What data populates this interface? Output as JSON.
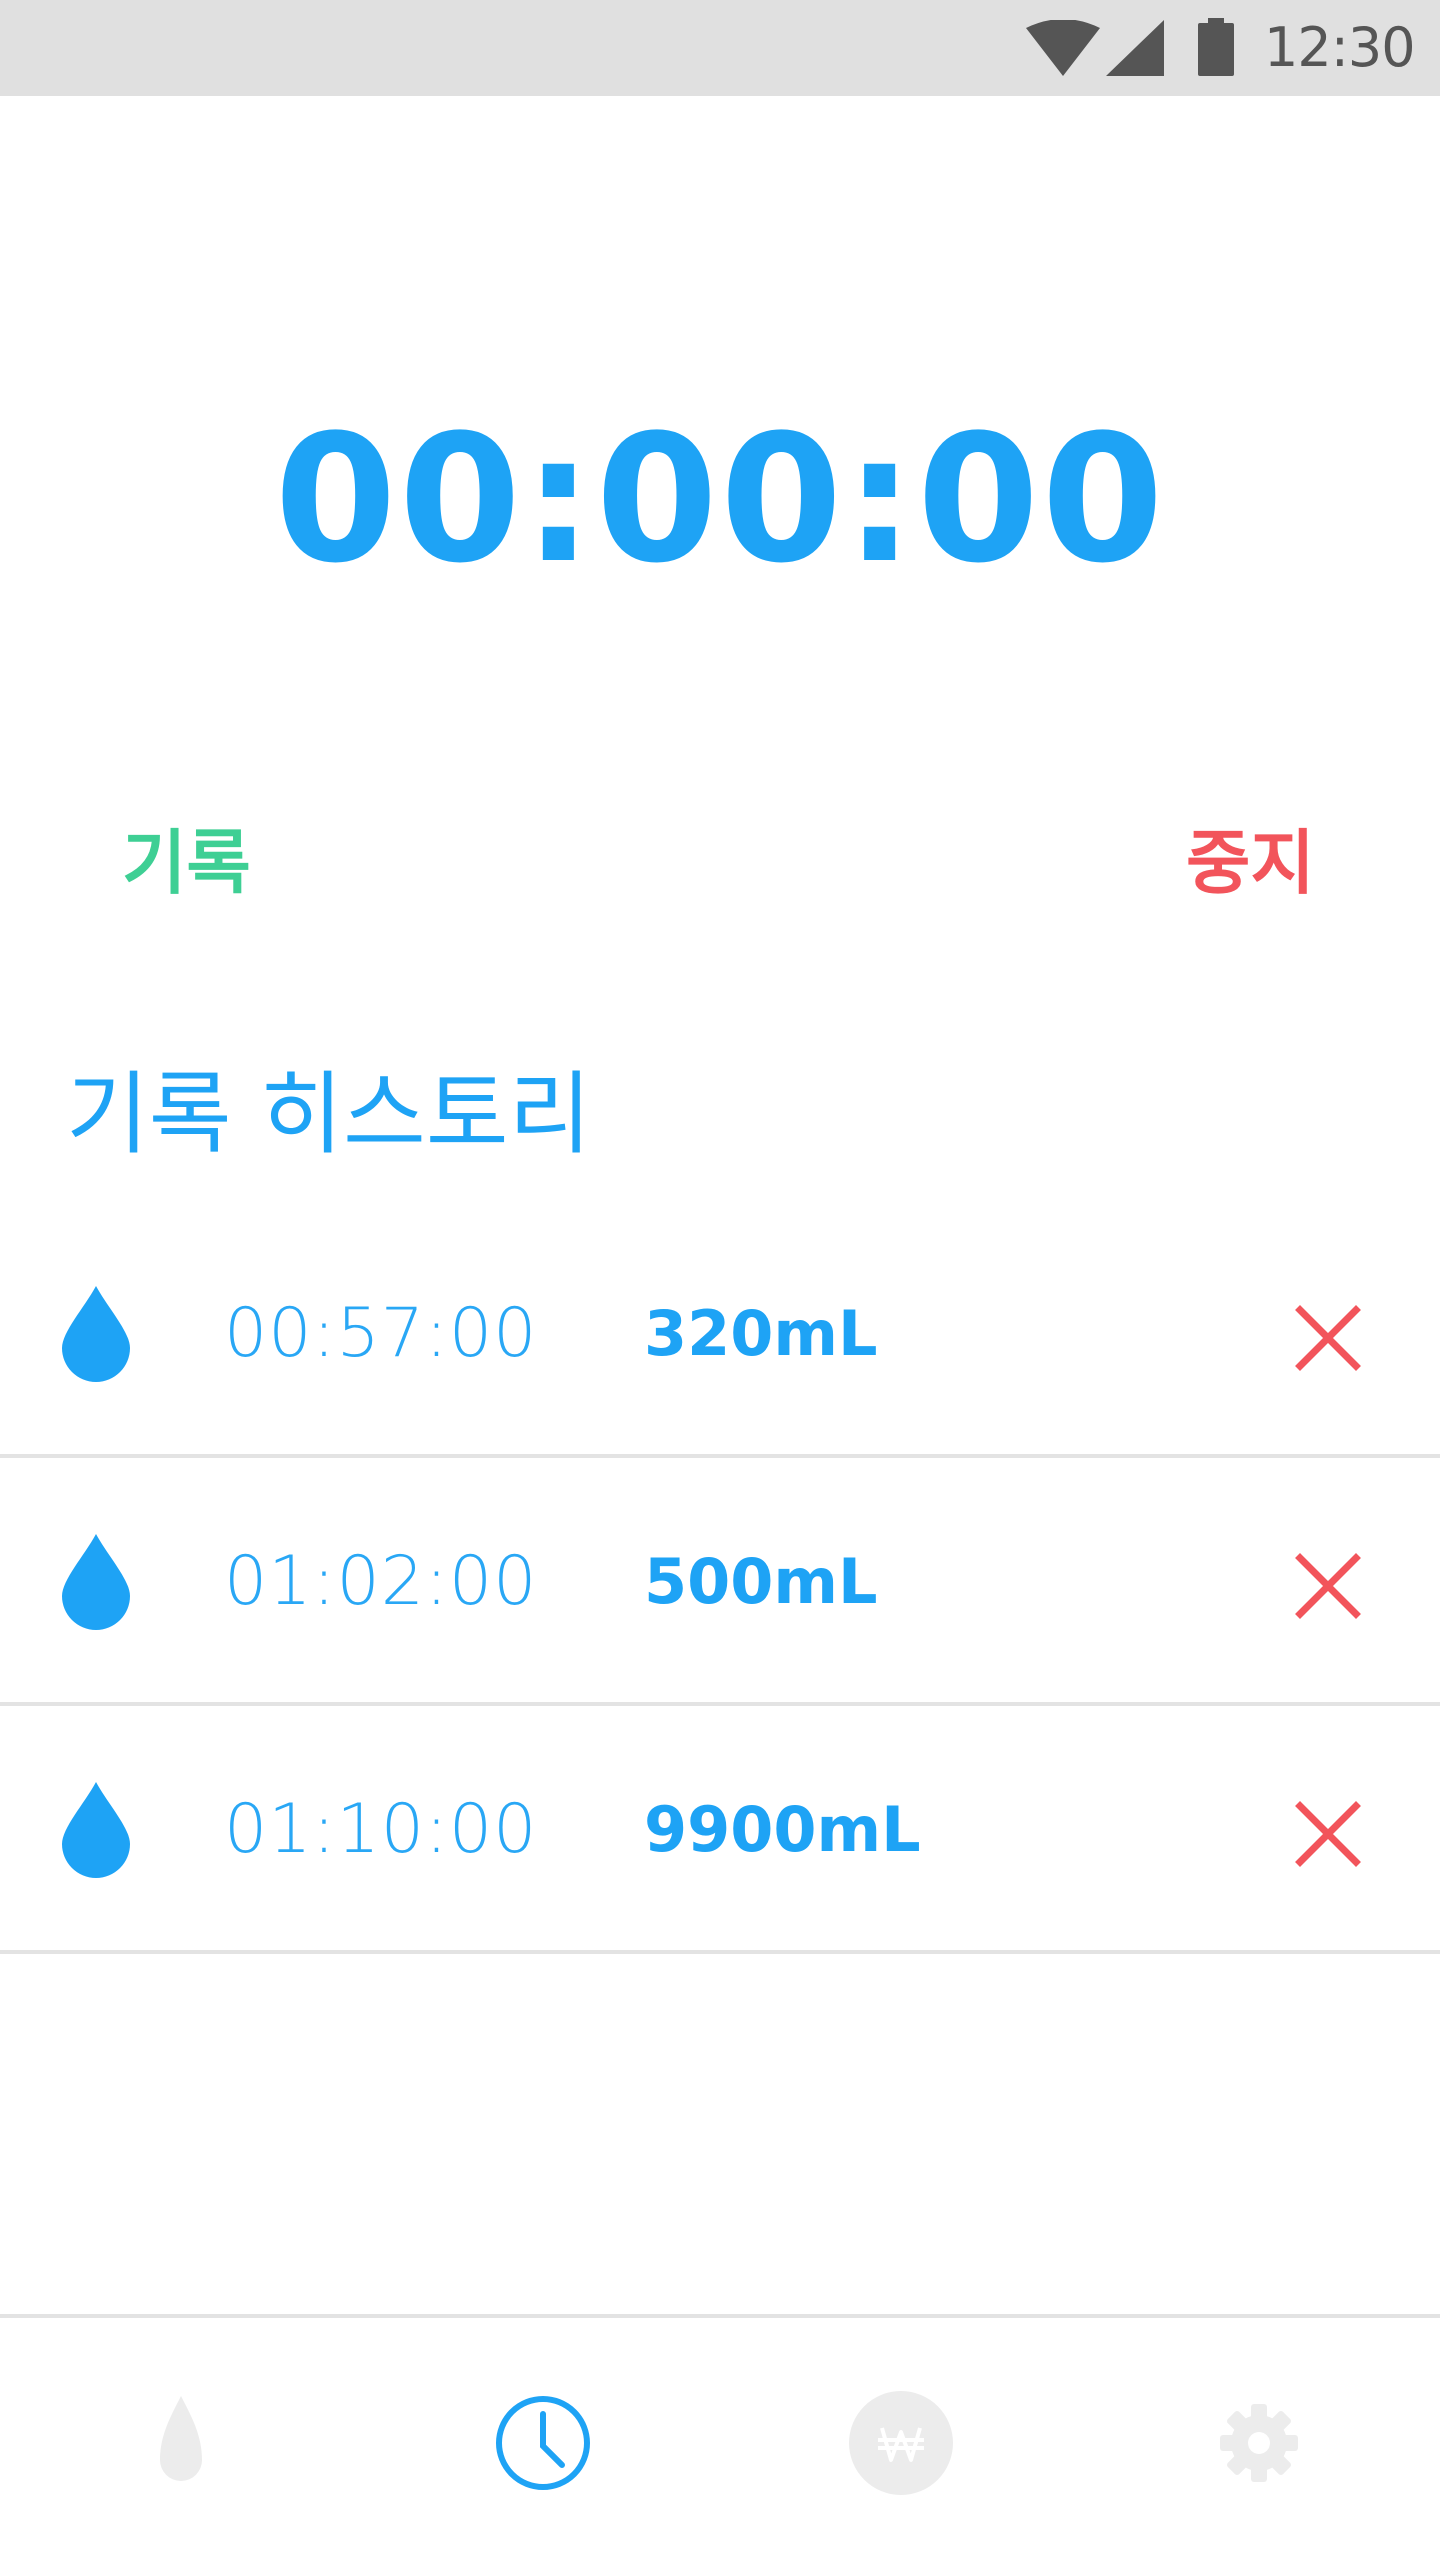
{
  "status_bar": {
    "time": "12:30",
    "icons": [
      "wifi-icon",
      "signal-icon",
      "battery-icon"
    ]
  },
  "timer": {
    "display": "00:00:00"
  },
  "actions": {
    "record_label": "기록",
    "stop_label": "중지"
  },
  "history": {
    "title": "기록 히스토리",
    "entries": [
      {
        "time": "00:57:00",
        "amount": "320mL"
      },
      {
        "time": "01:02:00",
        "amount": "500mL"
      },
      {
        "time": "01:10:00",
        "amount": "9900mL"
      }
    ]
  },
  "bottom_nav": {
    "items": [
      {
        "icon": "water-drop-icon",
        "active": false
      },
      {
        "icon": "clock-icon",
        "active": true
      },
      {
        "icon": "won-icon",
        "active": false
      },
      {
        "icon": "gear-icon",
        "active": false
      }
    ]
  },
  "colors": {
    "primary": "#1ea3f5",
    "record": "#3ecf94",
    "stop": "#f2545b",
    "inactive": "#ececec",
    "divider": "#e3e3e3",
    "status_bar": "#e0e0e0"
  }
}
